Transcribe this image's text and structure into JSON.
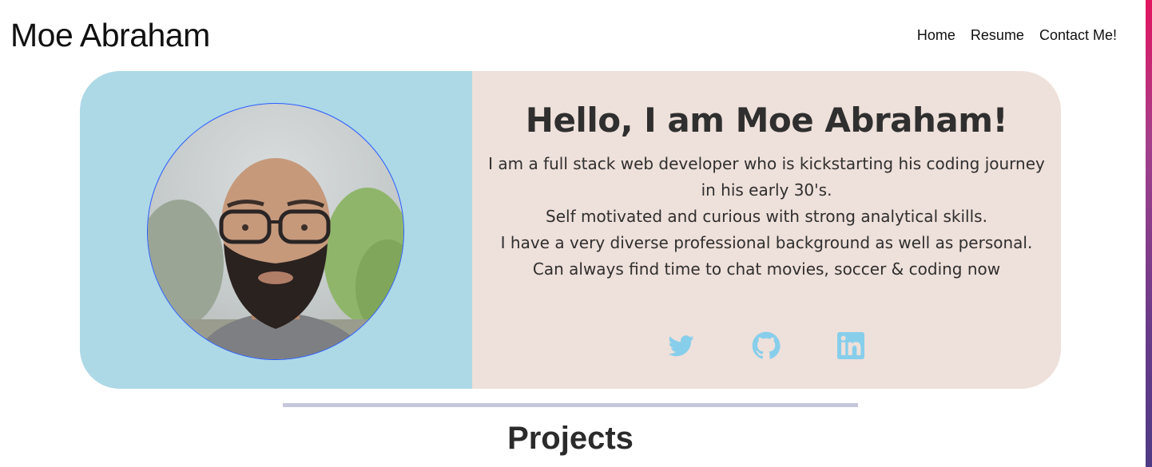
{
  "header": {
    "brand": "Moe Abraham",
    "nav": [
      {
        "label": "Home"
      },
      {
        "label": "Resume"
      },
      {
        "label": "Contact Me!"
      }
    ]
  },
  "hero": {
    "title": "Hello, I am Moe Abraham!",
    "bio": [
      "I am a full stack web developer who is kickstarting his coding journey in his early 30's.",
      "Self motivated and curious with strong analytical skills.",
      "I have a very diverse professional background as well as personal.",
      "Can always find time to chat movies, soccer & coding now"
    ],
    "avatar_alt": "Moe Abraham",
    "socials": [
      {
        "icon": "twitter-icon"
      },
      {
        "icon": "github-icon"
      },
      {
        "icon": "linkedin-icon"
      }
    ]
  },
  "projects": {
    "title": "Projects"
  },
  "colors": {
    "hero_left_bg": "#add8e6",
    "hero_right_bg": "#eee0da",
    "social_icon": "#87ceeb",
    "divider": "#c6c6dd",
    "avatar_border": "#2a5cff"
  }
}
